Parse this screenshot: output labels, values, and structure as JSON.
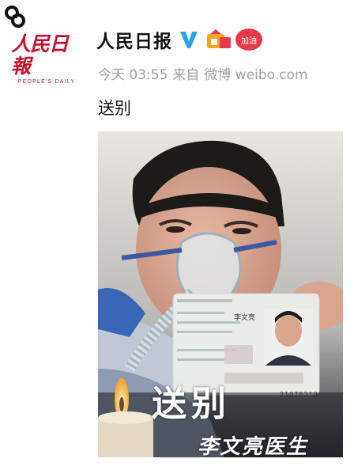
{
  "account": {
    "name": "人民日报",
    "avatar_title": "人民日報",
    "avatar_subtitle": "PEOPLE'S DAILY",
    "like_badge_text": "加油"
  },
  "post": {
    "time_label": "今天 03:55",
    "source_prefix": "来自",
    "source": "微博 weibo.com",
    "text": "送别"
  },
  "photo": {
    "caption_main": "送别",
    "caption_sub": "李文亮医生",
    "id_card_name": "李文亮",
    "id_card_number_fragment": "21078219"
  },
  "colors": {
    "brand_red": "#c8102e",
    "verified_blue": "#2ba3e6",
    "meta_gray": "#a0a0a0"
  },
  "icons": {
    "corner_logo": "stylized-s-logo-icon",
    "verified": "verified-v-icon",
    "member": "member-badge-icon",
    "like": "heart-badge-icon"
  }
}
